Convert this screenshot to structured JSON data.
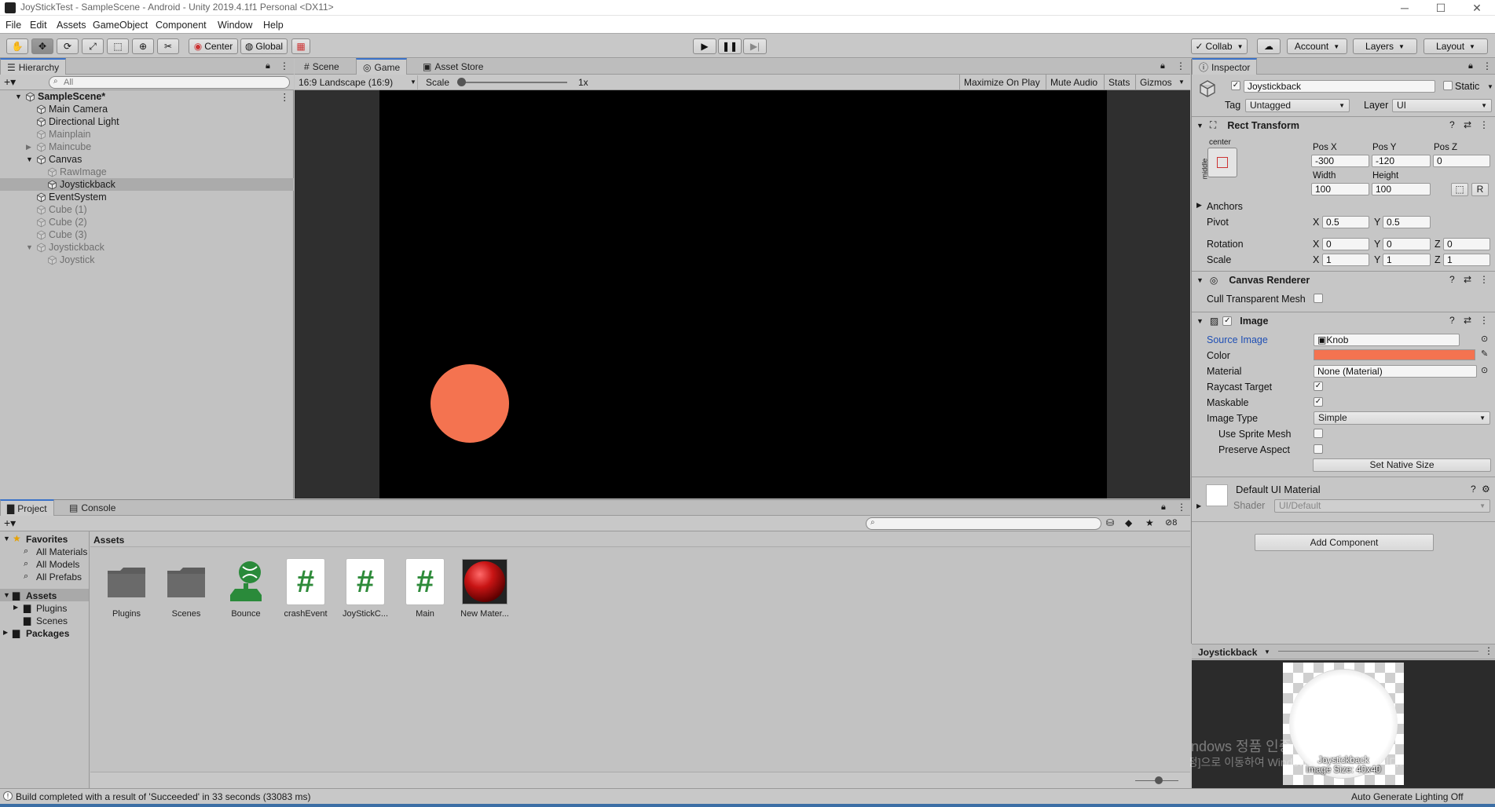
{
  "window": {
    "title": "JoyStickTest - SampleScene - Android - Unity 2019.4.1f1 Personal <DX11>",
    "minimize": "─",
    "maximize": "☐",
    "close": "✕"
  },
  "menu": [
    "File",
    "Edit",
    "Assets",
    "GameObject",
    "Component",
    "Window",
    "Help"
  ],
  "toolbar": {
    "center": "Center",
    "global": "Global",
    "collab": "Collab",
    "account": "Account",
    "layers": "Layers",
    "layout": "Layout"
  },
  "hierarchy": {
    "tab": "Hierarchy",
    "search_placeholder": "All",
    "items": [
      {
        "label": "SampleScene*",
        "depth": 0,
        "arrow": "down",
        "dim": false,
        "scene": true
      },
      {
        "label": "Main Camera",
        "depth": 1,
        "arrow": "",
        "dim": false
      },
      {
        "label": "Directional Light",
        "depth": 1,
        "arrow": "",
        "dim": false
      },
      {
        "label": "Mainplain",
        "depth": 1,
        "arrow": "",
        "dim": true
      },
      {
        "label": "Maincube",
        "depth": 1,
        "arrow": "right",
        "dim": true
      },
      {
        "label": "Canvas",
        "depth": 1,
        "arrow": "down",
        "dim": false
      },
      {
        "label": "RawImage",
        "depth": 2,
        "arrow": "",
        "dim": true
      },
      {
        "label": "Joystickback",
        "depth": 2,
        "arrow": "",
        "dim": false,
        "selected": true
      },
      {
        "label": "EventSystem",
        "depth": 1,
        "arrow": "",
        "dim": false
      },
      {
        "label": "Cube (1)",
        "depth": 1,
        "arrow": "",
        "dim": true
      },
      {
        "label": "Cube (2)",
        "depth": 1,
        "arrow": "",
        "dim": true
      },
      {
        "label": "Cube (3)",
        "depth": 1,
        "arrow": "",
        "dim": true
      },
      {
        "label": "Joystickback",
        "depth": 1,
        "arrow": "down",
        "dim": true
      },
      {
        "label": "Joystick",
        "depth": 2,
        "arrow": "",
        "dim": true
      }
    ]
  },
  "game": {
    "tabs": [
      "Scene",
      "Game",
      "Asset Store"
    ],
    "resolution": "16:9 Landscape (16:9)",
    "scale_label": "Scale",
    "scale_value": "1x",
    "options": [
      "Maximize On Play",
      "Mute Audio",
      "Stats",
      "Gizmos"
    ],
    "knob_color": "#f47350"
  },
  "inspector": {
    "tab": "Inspector",
    "object_name": "Joystickback",
    "static": "Static",
    "tag_label": "Tag",
    "tag": "Untagged",
    "layer_label": "Layer",
    "layer": "UI",
    "rect": {
      "title": "Rect Transform",
      "anchor_h": "center",
      "anchor_v": "middle",
      "posx_label": "Pos X",
      "posy_label": "Pos Y",
      "posz_label": "Pos Z",
      "posx": "-300",
      "posy": "-120",
      "posz": "0",
      "width_label": "Width",
      "height_label": "Height",
      "width": "100",
      "height": "100",
      "r": "R",
      "anchors": "Anchors",
      "pivot": "Pivot",
      "pivot_x": "0.5",
      "pivot_y": "0.5",
      "rotation": "Rotation",
      "rot_x": "0",
      "rot_y": "0",
      "rot_z": "0",
      "scale": "Scale",
      "scale_x": "1",
      "scale_y": "1",
      "scale_z": "1",
      "x": "X",
      "y": "Y",
      "z": "Z"
    },
    "canvas_renderer": {
      "title": "Canvas Renderer",
      "cull": "Cull Transparent Mesh"
    },
    "image": {
      "title": "Image",
      "source_label": "Source Image",
      "source": "Knob",
      "color_label": "Color",
      "color": "#f47350",
      "material_label": "Material",
      "material": "None (Material)",
      "raycast": "Raycast Target",
      "maskable": "Maskable",
      "type_label": "Image Type",
      "type": "Simple",
      "use_sprite_mesh": "Use Sprite Mesh",
      "preserve": "Preserve Aspect",
      "native": "Set Native Size"
    },
    "material": {
      "title": "Default UI Material",
      "shader_label": "Shader",
      "shader": "UI/Default"
    },
    "add_component": "Add Component",
    "preview": {
      "title": "Joystickback",
      "line1": "Joystickback",
      "line2": "Image Size: 40x40"
    },
    "watermark1": "Windows 정품 인증",
    "watermark2": "[설정]으로 이동하여 Windows를 정품 인증합니다."
  },
  "project": {
    "tabs": [
      "Project",
      "Console"
    ],
    "favorites": "Favorites",
    "fav_items": [
      "All Materials",
      "All Models",
      "All Prefabs"
    ],
    "assets_root": "Assets",
    "asset_children": [
      "Plugins",
      "Scenes"
    ],
    "packages": "Packages",
    "breadcrumb": "Assets",
    "hidden_count": "8",
    "assets": [
      {
        "label": "Plugins",
        "kind": "folder"
      },
      {
        "label": "Scenes",
        "kind": "folder"
      },
      {
        "label": "Bounce",
        "kind": "physmat"
      },
      {
        "label": "crashEvent",
        "kind": "script"
      },
      {
        "label": "JoyStickC...",
        "kind": "script"
      },
      {
        "label": "Main",
        "kind": "script"
      },
      {
        "label": "New Mater...",
        "kind": "material"
      }
    ]
  },
  "status": {
    "message": "Build completed with a result of 'Succeeded' in 33 seconds (33083 ms)",
    "lighting": "Auto Generate Lighting Off"
  }
}
